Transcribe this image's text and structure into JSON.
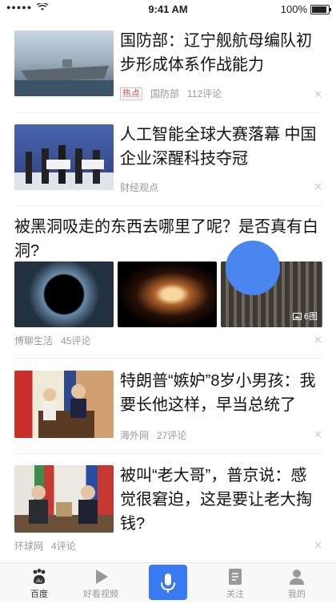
{
  "status": {
    "carrier_dots": "●●●●●",
    "time": "9:41 AM",
    "battery": "100%",
    "battery_level": 1.0
  },
  "feed": [
    {
      "title": "国防部：辽宁舰航母编队初步形成体系作战能力",
      "tag": "热点",
      "source": "国防部",
      "comments": "112评论"
    },
    {
      "title": "人工智能全球大赛落幕 中国企业深醒科技夺冠",
      "source": "财经观点"
    },
    {
      "title": "被黑洞吸走的东西去哪里了呢？是否真有白洞?",
      "source": "博聊生活",
      "comments": "45评论",
      "image_count": "6图"
    },
    {
      "title": "特朗普“嫉妒”8岁小男孩：我要长他这样，早当总统了",
      "source": "海外网",
      "comments": "27评论"
    },
    {
      "title": "被叫“老大哥”，普京说：感觉很窘迫，这是要让老大掏钱?",
      "source": "环球网",
      "comments": "4评论"
    }
  ],
  "close_glyph": "✕",
  "tabbar": {
    "items": [
      {
        "label": "百度",
        "icon": "baidu-paw-icon"
      },
      {
        "label": "好看视频",
        "icon": "play-icon"
      },
      {
        "label": "",
        "icon": "microphone-icon"
      },
      {
        "label": "关注",
        "icon": "bookmark-icon"
      },
      {
        "label": "我的",
        "icon": "person-icon"
      }
    ]
  },
  "colors": {
    "accent": "#3a7af0",
    "floating_circle": "#4a86f0",
    "hot_tag": "#e44444"
  }
}
